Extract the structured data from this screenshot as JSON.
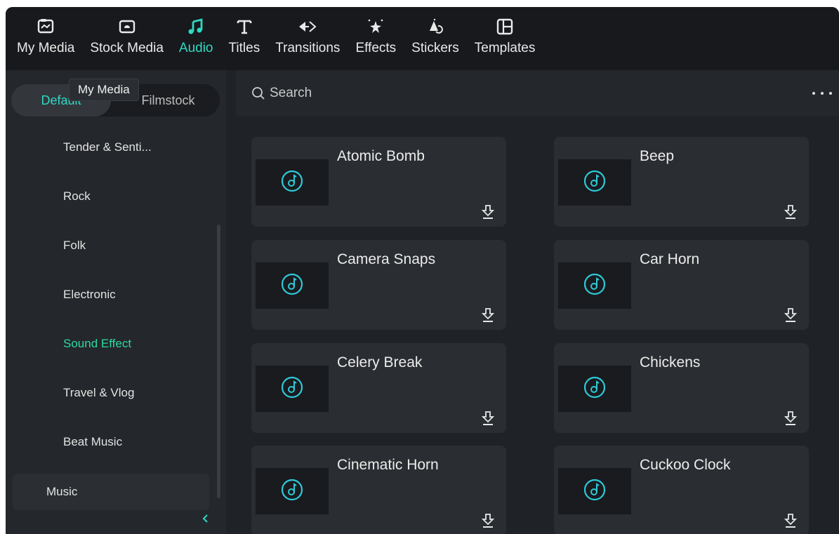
{
  "colors": {
    "accent": "#2fd8c4",
    "active_category": "#2fd8a0",
    "app_bg": "#1f2226",
    "toolbar_bg": "#17191c",
    "card_bg": "#2a2d31"
  },
  "toolbar": {
    "tabs": [
      {
        "label": "My Media",
        "icon": "my-media-icon"
      },
      {
        "label": "Stock Media",
        "icon": "stock-media-icon"
      },
      {
        "label": "Audio",
        "icon": "music-note-icon",
        "active": true
      },
      {
        "label": "Titles",
        "icon": "text-t-icon"
      },
      {
        "label": "Transitions",
        "icon": "transition-arrows-icon"
      },
      {
        "label": "Effects",
        "icon": "sparkle-effects-icon"
      },
      {
        "label": "Stickers",
        "icon": "sticker-icon"
      },
      {
        "label": "Templates",
        "icon": "template-layout-icon"
      }
    ]
  },
  "tooltip": {
    "text": "My Media"
  },
  "source_toggle": {
    "default_label": "Default",
    "filmstock_label": "Filmstock",
    "selected": "Default"
  },
  "sidebar": {
    "categories": [
      {
        "label": "Tender & Senti..."
      },
      {
        "label": "Rock"
      },
      {
        "label": "Folk"
      },
      {
        "label": "Electronic"
      },
      {
        "label": "Sound Effect",
        "active": true
      },
      {
        "label": "Travel & Vlog"
      },
      {
        "label": "Beat Music"
      }
    ],
    "music_label": "Music",
    "collapse_icon": "chevron-left-icon"
  },
  "search": {
    "placeholder": "Search",
    "value": ""
  },
  "more_menu": {
    "icon": "more-horizontal-icon"
  },
  "audio_items": [
    {
      "title": "Atomic Bomb"
    },
    {
      "title": "Beep"
    },
    {
      "title": "Camera Snaps"
    },
    {
      "title": "Car Horn"
    },
    {
      "title": "Celery Break"
    },
    {
      "title": "Chickens"
    },
    {
      "title": "Cinematic Horn"
    },
    {
      "title": "Cuckoo Clock"
    }
  ]
}
